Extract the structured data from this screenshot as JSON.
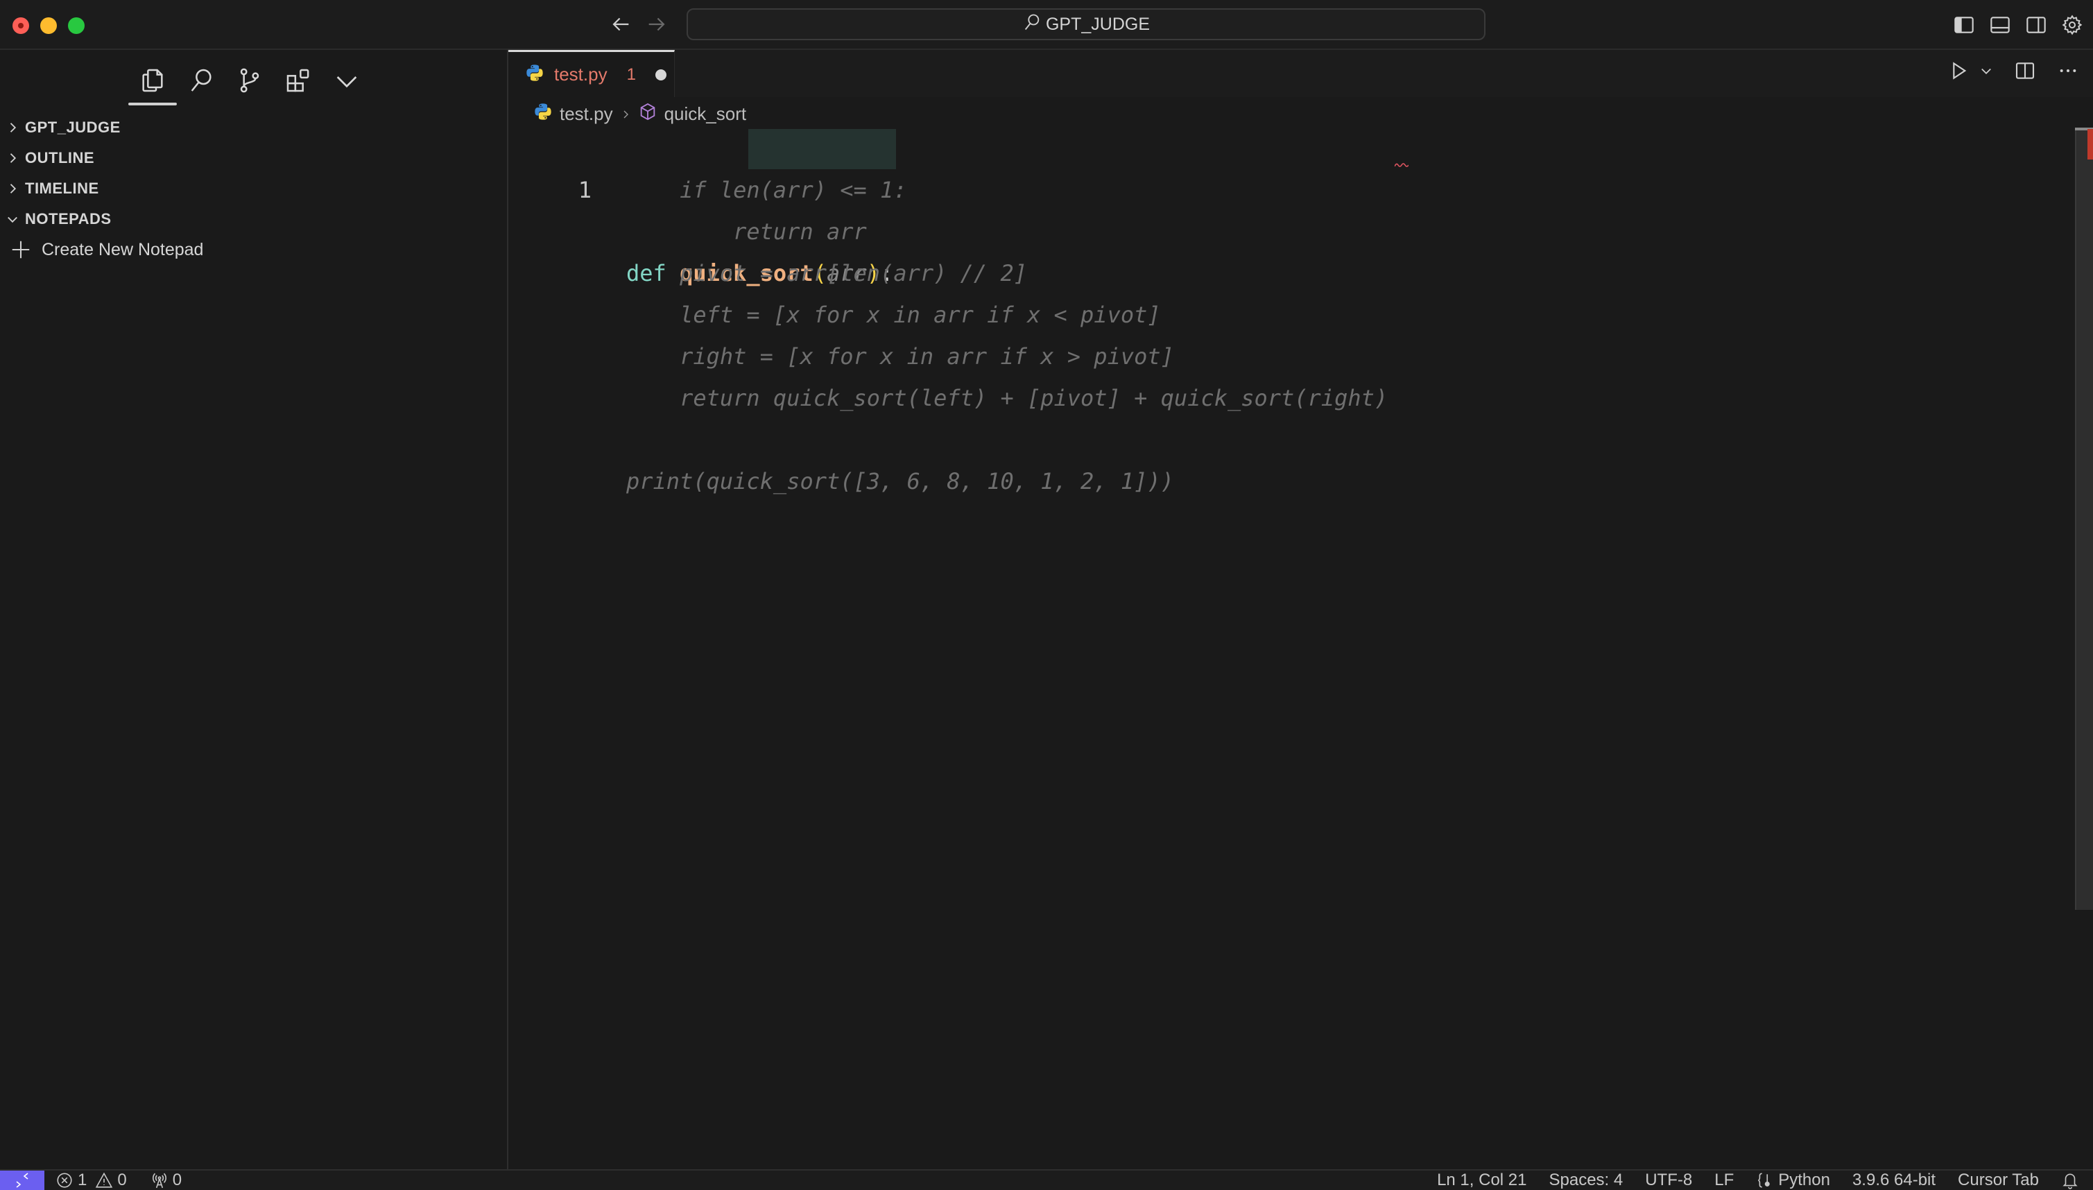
{
  "titlebar": {
    "search_label": "GPT_JUDGE",
    "icons": [
      "arrow-left-icon",
      "arrow-right-icon",
      "toggle-primary-sidebar-icon",
      "toggle-panel-icon",
      "toggle-secondary-sidebar-icon",
      "settings-gear-icon"
    ]
  },
  "sidebar": {
    "activity": [
      "explorer-icon",
      "search-icon",
      "source-control-icon",
      "extensions-icon",
      "more-chevron-icon"
    ],
    "sections": [
      {
        "label": "GPT_JUDGE",
        "expanded": false
      },
      {
        "label": "OUTLINE",
        "expanded": false
      },
      {
        "label": "TIMELINE",
        "expanded": false
      },
      {
        "label": "NOTEPADS",
        "expanded": true
      }
    ],
    "notepad_action": "Create New Notepad"
  },
  "editor": {
    "tab": {
      "name": "test.py",
      "problems": "1",
      "dirty": true
    },
    "breadcrumb": {
      "file": "test.py",
      "symbol": "quick_sort"
    },
    "line_number": "1",
    "line1": {
      "kw": "def",
      "fn": "quick_sort",
      "open": "(",
      "param": "arr",
      "close": ")",
      "colon": ":"
    },
    "ghost_lines": [
      "    if len(arr) <= 1:",
      "        return arr",
      "    pivot = arr[len(arr) // 2]",
      "    left = [x for x in arr if x < pivot]",
      "    right = [x for x in arr if x > pivot]",
      "    return quick_sort(left) + [pivot] + quick_sort(right)",
      "",
      "print(quick_sort([3, 6, 8, 10, 1, 2, 1]))"
    ]
  },
  "statusbar": {
    "errors": "1",
    "warnings": "0",
    "ports": "0",
    "position": "Ln 1, Col 21",
    "spaces": "Spaces: 4",
    "encoding": "UTF-8",
    "eol": "LF",
    "language": "Python",
    "interpreter": "3.9.6 64-bit",
    "cursor_tab": "Cursor Tab"
  },
  "colors": {
    "remote_accent": "#6b5ff0",
    "tab_error_text": "#e47a6b",
    "keyword": "#83d6c5",
    "function": "#efb080",
    "bracket": "#f7d449"
  }
}
